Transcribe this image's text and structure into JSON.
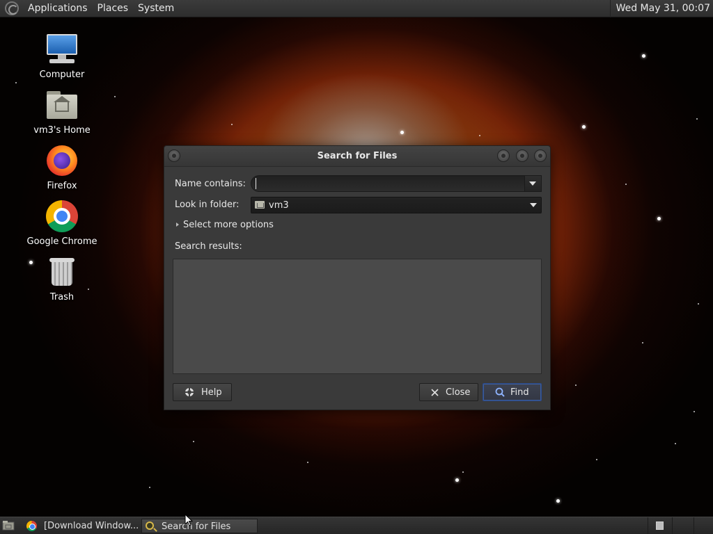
{
  "top_panel": {
    "menus": [
      "Applications",
      "Places",
      "System"
    ],
    "clock": "Wed May 31, 00:07"
  },
  "desktop_icons": [
    {
      "label": "Computer",
      "icon": "computer-icon"
    },
    {
      "label": "vm3's Home",
      "icon": "home-folder-icon"
    },
    {
      "label": "Firefox",
      "icon": "firefox-icon"
    },
    {
      "label": "Google Chrome",
      "icon": "chrome-icon"
    },
    {
      "label": "Trash",
      "icon": "trash-icon"
    }
  ],
  "dialog": {
    "title": "Search for Files",
    "name_label": "Name contains:",
    "name_value": "",
    "folder_label": "Look in folder:",
    "folder_value": "vm3",
    "more_options": "Select more options",
    "results_label": "Search results:",
    "buttons": {
      "help": "Help",
      "close": "Close",
      "find": "Find"
    }
  },
  "taskbar": {
    "tasks": [
      {
        "label": "[Download Window...",
        "icon": "chrome-icon",
        "active": false
      },
      {
        "label": "Search for Files",
        "icon": "search-icon",
        "active": true
      }
    ]
  },
  "colors": {
    "panel": "#2d2d2d",
    "dialog_bg": "#3a3a3a",
    "find_button_border": "#2a4a8a"
  }
}
